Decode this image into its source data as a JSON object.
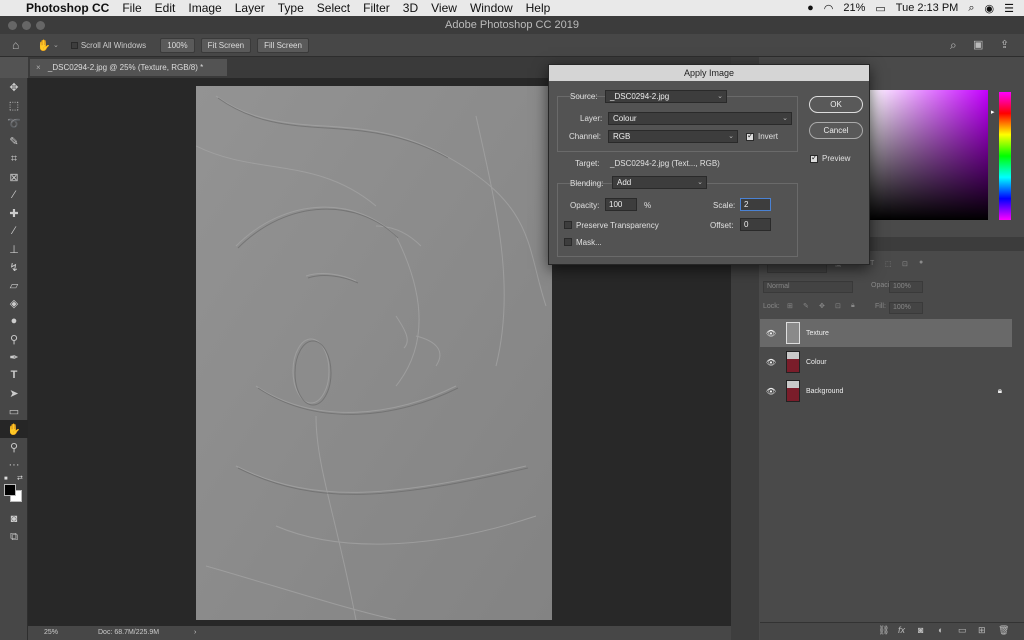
{
  "menubar": {
    "app": "Photoshop CC",
    "items": [
      "File",
      "Edit",
      "Image",
      "Layer",
      "Type",
      "Select",
      "Filter",
      "3D",
      "View",
      "Window",
      "Help"
    ],
    "battery": "21%",
    "clock": "Tue 2:13 PM"
  },
  "window_title": "Adobe Photoshop CC 2019",
  "options": {
    "scroll_all_label": "Scroll All Windows",
    "zoom_btn": "100%",
    "fit_btn": "Fit Screen",
    "fill_btn": "Fill Screen"
  },
  "document": {
    "tab_title": "_DSC0294-2.jpg @ 25% (Texture, RGB/8) *",
    "tab_close": "×",
    "zoom": "25%",
    "doc_size": "Doc: 68.7M/225.9M"
  },
  "dialog": {
    "title": "Apply Image",
    "source_label": "Source:",
    "source_value": "_DSC0294-2.jpg",
    "layer_label": "Layer:",
    "layer_value": "Colour",
    "channel_label": "Channel:",
    "channel_value": "RGB",
    "invert_label": "Invert",
    "invert_checked": true,
    "target_label": "Target:",
    "target_value": "_DSC0294-2.jpg (Text..., RGB)",
    "blending_label": "Blending:",
    "blending_value": "Add",
    "opacity_label": "Opacity:",
    "opacity_value": "100",
    "opacity_unit": "%",
    "scale_label": "Scale:",
    "scale_value": "2",
    "offset_label": "Offset:",
    "offset_value": "0",
    "preserve_label": "Preserve Transparency",
    "preserve_checked": false,
    "mask_label": "Mask...",
    "mask_checked": false,
    "ok_label": "OK",
    "cancel_label": "Cancel",
    "preview_label": "Preview",
    "preview_checked": true
  },
  "layers_panel": {
    "blend_mode": "Normal",
    "opacity_label": "Opacity:",
    "opacity_value": "100%",
    "lock_label": "Lock:",
    "fill_label": "Fill:",
    "fill_value": "100%",
    "layers": [
      {
        "name": "Texture",
        "selected": true
      },
      {
        "name": "Colour",
        "selected": false
      },
      {
        "name": "Background",
        "selected": false,
        "locked": true
      }
    ]
  },
  "colors": {
    "accent": "#c400ff",
    "dialog_bg": "#535353",
    "canvas_bg": "#282828"
  }
}
